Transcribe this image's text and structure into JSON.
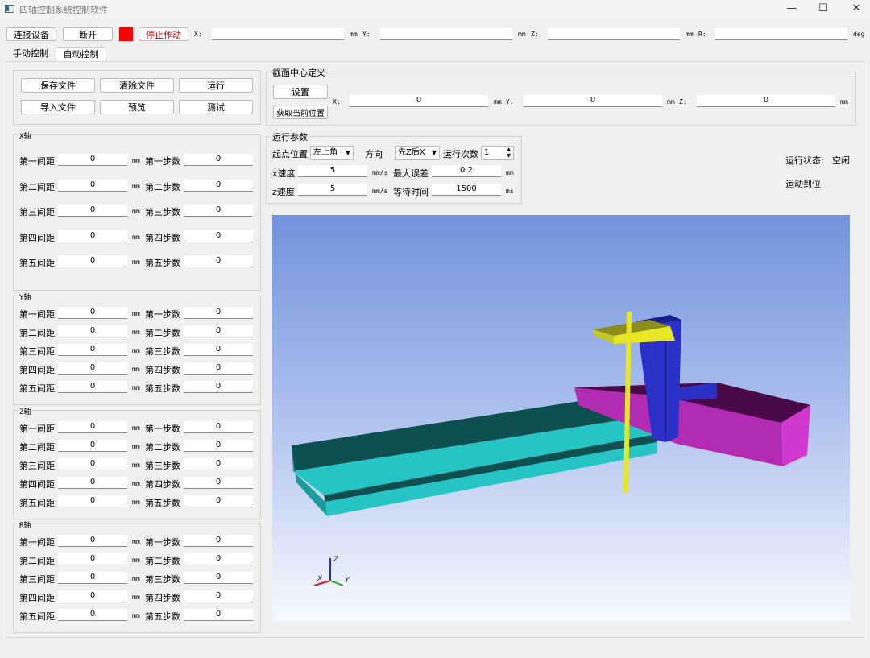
{
  "window": {
    "title": "四轴控制系统控制软件",
    "min": "—",
    "max": "☐",
    "close": "✕"
  },
  "toolbar": {
    "connect": "连接设备",
    "disconnect": "断开",
    "stop": "停止作动",
    "indicator_color": "#ff0000",
    "x_label": "X:",
    "x_unit": "mm",
    "y_label": "Y:",
    "y_unit": "mm",
    "z_label": "Z:",
    "z_unit": "mm",
    "r_label": "R:",
    "r_unit": "deg",
    "x_value": "",
    "y_value": "",
    "z_value": "",
    "r_value": ""
  },
  "tabs": {
    "manual": "手动控制",
    "auto": "自动控制"
  },
  "file_buttons": {
    "save": "保存文件",
    "clear": "清除文件",
    "run": "运行",
    "import": "导入文件",
    "preview": "预览",
    "test": "测试"
  },
  "axes": [
    {
      "title": "X轴",
      "rows": [
        {
          "dist_label": "第一间距",
          "dist": "0",
          "unit": "mm",
          "step_label": "第一步数",
          "step": "0"
        },
        {
          "dist_label": "第二间距",
          "dist": "0",
          "unit": "mm",
          "step_label": "第二步数",
          "step": "0"
        },
        {
          "dist_label": "第三间距",
          "dist": "0",
          "unit": "mm",
          "step_label": "第三步数",
          "step": "0"
        },
        {
          "dist_label": "第四间距",
          "dist": "0",
          "unit": "mm",
          "step_label": "第四步数",
          "step": "0"
        },
        {
          "dist_label": "第五间距",
          "dist": "0",
          "unit": "mm",
          "step_label": "第五步数",
          "step": "0"
        }
      ]
    },
    {
      "title": "Y轴",
      "rows": [
        {
          "dist_label": "第一间距",
          "dist": "0",
          "unit": "mm",
          "step_label": "第一步数",
          "step": "0"
        },
        {
          "dist_label": "第二间距",
          "dist": "0",
          "unit": "mm",
          "step_label": "第二步数",
          "step": "0"
        },
        {
          "dist_label": "第三间距",
          "dist": "0",
          "unit": "mm",
          "step_label": "第三步数",
          "step": "0"
        },
        {
          "dist_label": "第四间距",
          "dist": "0",
          "unit": "mm",
          "step_label": "第四步数",
          "step": "0"
        },
        {
          "dist_label": "第五间距",
          "dist": "0",
          "unit": "mm",
          "step_label": "第五步数",
          "step": "0"
        }
      ]
    },
    {
      "title": "Z轴",
      "rows": [
        {
          "dist_label": "第一间距",
          "dist": "0",
          "unit": "mm",
          "step_label": "第一步数",
          "step": "0"
        },
        {
          "dist_label": "第二间距",
          "dist": "0",
          "unit": "mm",
          "step_label": "第二步数",
          "step": "0"
        },
        {
          "dist_label": "第三间距",
          "dist": "0",
          "unit": "mm",
          "step_label": "第三步数",
          "step": "0"
        },
        {
          "dist_label": "第四间距",
          "dist": "0",
          "unit": "mm",
          "step_label": "第四步数",
          "step": "0"
        },
        {
          "dist_label": "第五间距",
          "dist": "0",
          "unit": "mm",
          "step_label": "第五步数",
          "step": "0"
        }
      ]
    },
    {
      "title": "R轴",
      "rows": [
        {
          "dist_label": "第一间距",
          "dist": "0",
          "unit": "mm",
          "step_label": "第一步数",
          "step": "0"
        },
        {
          "dist_label": "第二间距",
          "dist": "0",
          "unit": "mm",
          "step_label": "第二步数",
          "step": "0"
        },
        {
          "dist_label": "第三间距",
          "dist": "0",
          "unit": "mm",
          "step_label": "第三步数",
          "step": "0"
        },
        {
          "dist_label": "第四间距",
          "dist": "0",
          "unit": "mm",
          "step_label": "第四步数",
          "step": "0"
        },
        {
          "dist_label": "第五间距",
          "dist": "0",
          "unit": "mm",
          "step_label": "第五步数",
          "step": "0"
        }
      ]
    }
  ],
  "section_center": {
    "title": "截面中心定义",
    "set": "设置",
    "get_pos": "获取当前位置",
    "x_label": "X:",
    "x": "0",
    "x_unit": "mm",
    "y_label": "Y:",
    "y": "0",
    "y_unit": "mm",
    "z_label": "Z:",
    "z": "0",
    "z_unit": "mm"
  },
  "run_params": {
    "title": "运行参数",
    "start_label": "起点位置",
    "start_value": "左上角",
    "dir_label": "方向",
    "dir_value": "先Z后X",
    "count_label": "运行次数",
    "count": "1",
    "xspeed_label": "x速度",
    "xspeed": "5",
    "xspeed_unit": "mm/s",
    "maxerr_label": "最大误差",
    "maxerr": "0.2",
    "maxerr_unit": "mm",
    "zspeed_label": "z速度",
    "zspeed": "5",
    "zspeed_unit": "mm/s",
    "wait_label": "等待时间",
    "wait": "1500",
    "wait_unit": "ms"
  },
  "status": {
    "label": "运行状态:",
    "value": "空闲",
    "motion": "运动到位"
  },
  "scene": {
    "axis_x": "X",
    "axis_y": "Y",
    "axis_z": "Z",
    "colors": {
      "rail": "#26c4c4",
      "slider": "#b22cb2",
      "column": "#2a30c8",
      "arm": "#e6e624",
      "bg_top": "#7293dc",
      "bg_bottom": "#f7f9fe"
    }
  }
}
